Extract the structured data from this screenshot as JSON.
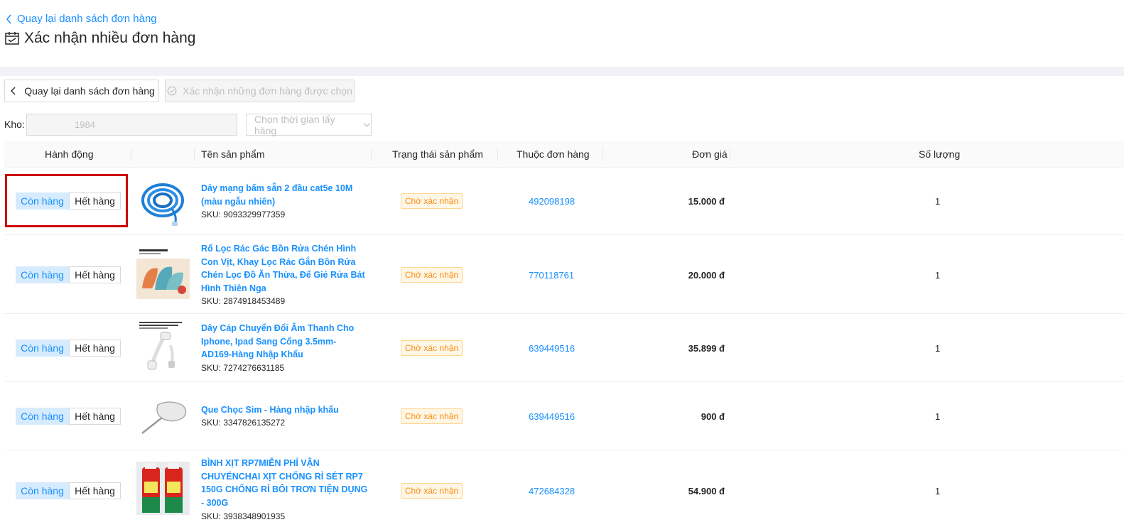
{
  "nav": {
    "back_link": "Quay lại danh sách đơn hàng"
  },
  "page": {
    "title": "Xác nhận nhiều đơn hàng"
  },
  "toolbar": {
    "back_button": "Quay lại danh sách đơn hàng",
    "confirm_button": "Xác nhận những đơn hàng được chọn"
  },
  "filters": {
    "kho_label": "Kho:",
    "kho_value": "1984",
    "time_placeholder": "Chọn thời gian lấy hàng"
  },
  "table": {
    "headers": {
      "action": "Hành động",
      "product_name": "Tên sản phẩm",
      "product_status": "Trạng thái sản phẩm",
      "order": "Thuộc đơn hàng",
      "unit_price": "Đơn giá",
      "quantity": "Số lượng"
    },
    "action_labels": {
      "in_stock": "Còn hàng",
      "out_of_stock": "Hết hàng"
    },
    "sku_prefix": "SKU:",
    "rows": [
      {
        "name": "Dây mạng bấm sẵn 2 đầu cat5e 10M (màu ngẫu nhiên)",
        "sku": "9093329977359",
        "status": "Chờ xác nhận",
        "order_id": "492098198",
        "price": "15.000 đ",
        "qty": "1"
      },
      {
        "name": "Rổ Lọc Rác Gác Bồn Rửa Chén Hình Con Vịt, Khay Lọc Rác Gắn Bồn Rửa Chén Lọc Đồ Ăn Thừa, Để Giẻ Rửa Bát Hình Thiên Nga",
        "sku": "2874918453489",
        "status": "Chờ xác nhận",
        "order_id": "770118761",
        "price": "20.000 đ",
        "qty": "1"
      },
      {
        "name": "Dây Cáp Chuyển Đổi Âm Thanh Cho Iphone, Ipad Sang Cổng 3.5mm- AD169-Hàng Nhập Khẩu",
        "sku": "7274276631185",
        "status": "Chờ xác nhận",
        "order_id": "639449516",
        "price": "35.899 đ",
        "qty": "1"
      },
      {
        "name": "Que Chọc Sim - Hàng nhập khẩu",
        "sku": "3347826135272",
        "status": "Chờ xác nhận",
        "order_id": "639449516",
        "price": "900 đ",
        "qty": "1"
      },
      {
        "name": "BÌNH XỊT RP7MIỄN PHÍ VẬN CHUYỂNCHAI XỊT CHỐNG RỈ SÉT RP7 150G CHỐNG RỈ BÔI TRƠN TIỆN DỤNG - 300G",
        "sku": "3938348901935",
        "status": "Chờ xác nhận",
        "order_id": "472684328",
        "price": "54.900 đ",
        "qty": "1"
      }
    ]
  },
  "colors": {
    "accent": "#1890ff",
    "status_orange": "#fa8c16",
    "highlight": "#cc0000"
  }
}
